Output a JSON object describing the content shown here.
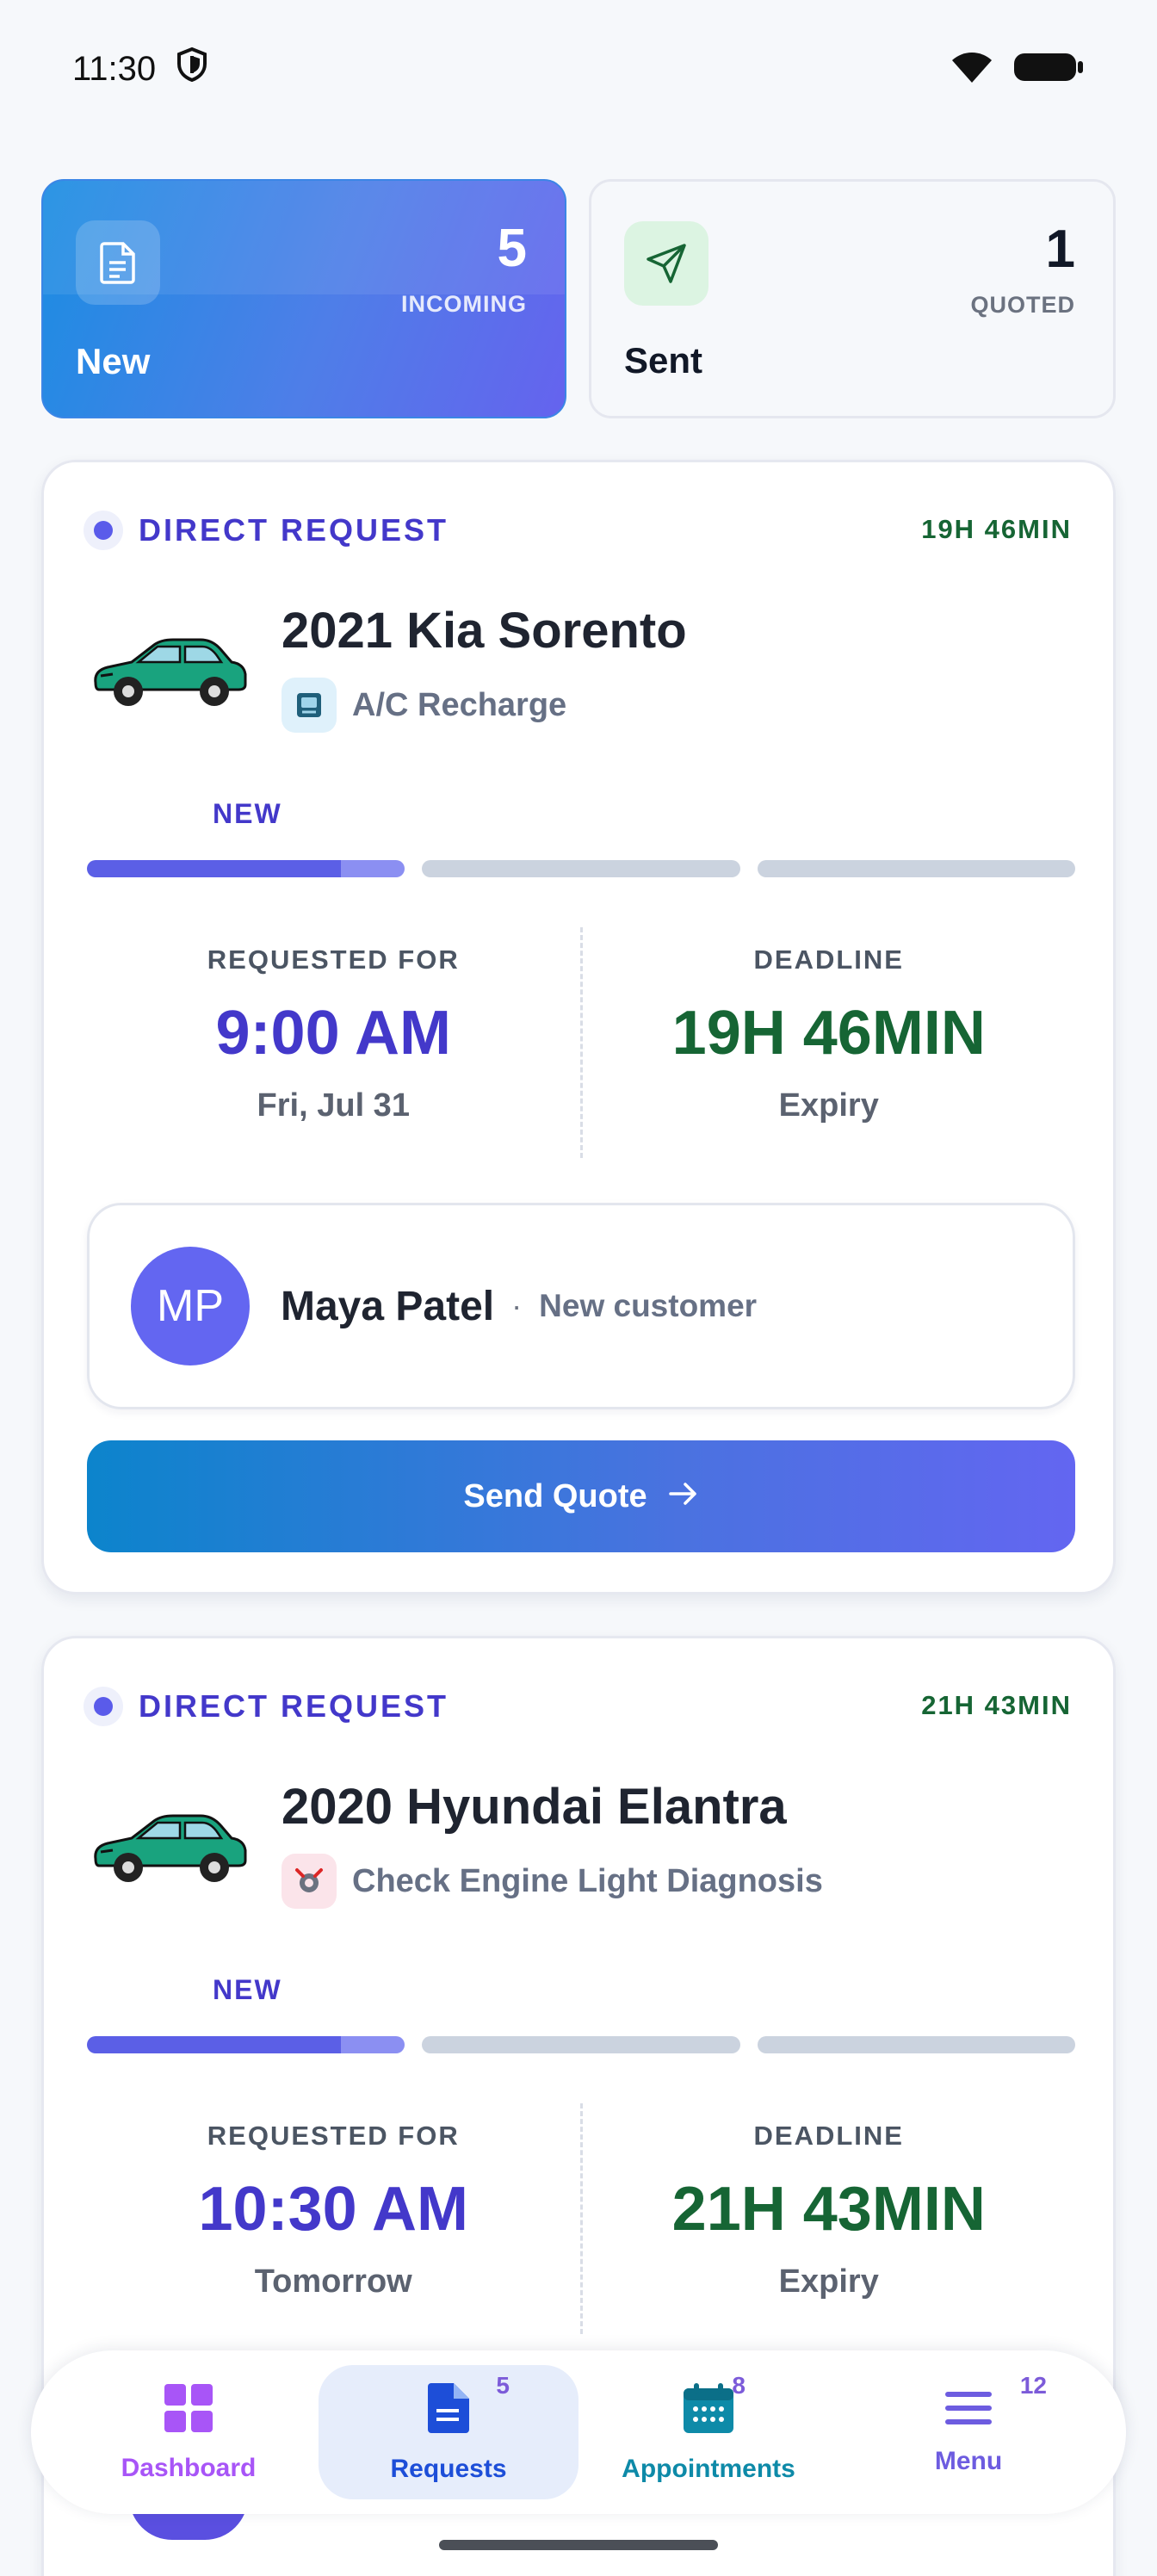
{
  "status_bar": {
    "time": "11:30"
  },
  "tabs": [
    {
      "title": "New",
      "count": "5",
      "count_label": "INCOMING"
    },
    {
      "title": "Sent",
      "count": "1",
      "count_label": "QUOTED"
    }
  ],
  "requests": [
    {
      "type": "DIRECT REQUEST",
      "timer": "19H 46MIN",
      "vehicle": "2021 Kia Sorento",
      "service": "A/C Recharge",
      "stage": "NEW",
      "progress_step": 1,
      "progress_total": 3,
      "requested_for_label": "REQUESTED FOR",
      "requested_time": "9:00 AM",
      "requested_date": "Fri, Jul 31",
      "deadline_label": "DEADLINE",
      "deadline": "19H 46MIN",
      "deadline_sub": "Expiry",
      "customer_initials": "MP",
      "customer_name": "Maya Patel",
      "customer_dot": "·",
      "customer_tag": "New customer",
      "action_label": "Send Quote"
    },
    {
      "type": "DIRECT REQUEST",
      "timer": "21H 43MIN",
      "vehicle": "2020 Hyundai Elantra",
      "service": "Check Engine Light Diagnosis",
      "stage": "NEW",
      "progress_step": 1,
      "progress_total": 3,
      "requested_for_label": "REQUESTED FOR",
      "requested_time": "10:30 AM",
      "requested_date": "Tomorrow",
      "deadline_label": "DEADLINE",
      "deadline": "21H 43MIN",
      "deadline_sub": "Expiry"
    }
  ],
  "nav": [
    {
      "label": "Dashboard",
      "badge": "",
      "color": "#a855f7"
    },
    {
      "label": "Requests",
      "badge": "5",
      "color": "#1d4ed8"
    },
    {
      "label": "Appointments",
      "badge": "8",
      "color": "#0e8aa8"
    },
    {
      "label": "Menu",
      "badge": "12",
      "color": "#6d5ce0"
    }
  ],
  "colors": {
    "accent": "#4338ca",
    "success": "#166534",
    "primary_gradient_start": "#0c84cc",
    "primary_gradient_end": "#6366f1"
  }
}
